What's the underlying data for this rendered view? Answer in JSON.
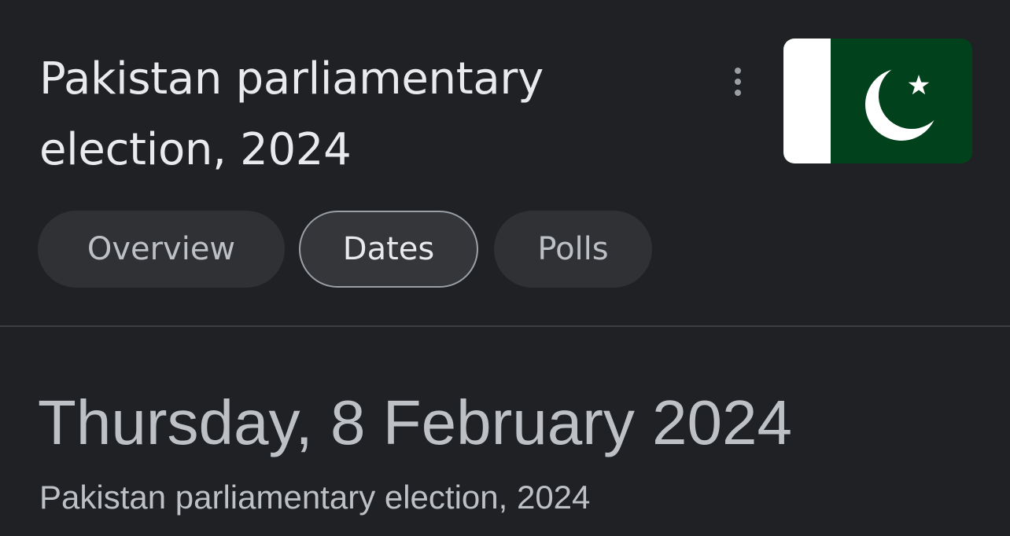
{
  "header": {
    "title": "Pakistan parliamentary election, 2024",
    "more_icon": "more-vert-icon",
    "flag_icon": "pakistan-flag-icon"
  },
  "tabs": [
    {
      "label": "Overview",
      "selected": false
    },
    {
      "label": "Dates",
      "selected": true
    },
    {
      "label": "Polls",
      "selected": false
    }
  ],
  "event": {
    "date": "Thursday, 8 February 2024",
    "subtitle": "Pakistan parliamentary election, 2024"
  },
  "colors": {
    "background": "#202124",
    "chip_background": "#303134",
    "flag_green": "#01411c",
    "flag_white": "#ffffff"
  }
}
